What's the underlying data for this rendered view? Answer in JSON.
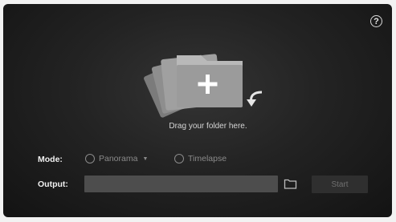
{
  "help": {
    "glyph": "?"
  },
  "dropzone": {
    "text": "Drag your folder here."
  },
  "mode": {
    "label": "Mode:",
    "options": [
      {
        "label": "Panorama",
        "has_dropdown": true,
        "selected": false
      },
      {
        "label": "Timelapse",
        "has_dropdown": false,
        "selected": false
      }
    ]
  },
  "output": {
    "label": "Output:",
    "value": "",
    "placeholder": ""
  },
  "start_button": {
    "label": "Start",
    "enabled": false
  },
  "icons": {
    "help": "help-circle-icon",
    "folder_stack": "folder-stack-icon",
    "add": "plus-icon",
    "undo_arrow": "curved-arrow-icon",
    "browse": "folder-outline-icon",
    "dropdown": "caret-down-icon"
  },
  "colors": {
    "background_center": "#343434",
    "background_edge": "#131313",
    "text_primary": "#f0f0f0",
    "text_muted": "#8a8a8a",
    "field_bg": "#4d4d4d",
    "button_disabled_bg": "#2f2f2f"
  }
}
